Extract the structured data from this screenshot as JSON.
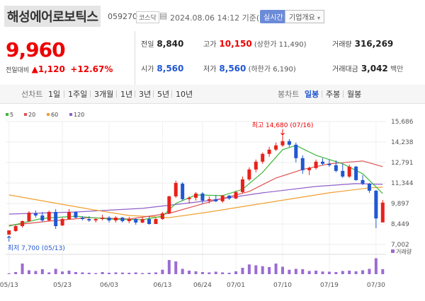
{
  "header": {
    "name": "해성에어로보틱스",
    "code": "059270",
    "market": "코스닥",
    "timestamp": "2024.08.06 14:12 기준(장중)",
    "realtime_label": "실시간",
    "overview_label": "기업개요",
    "overview_caret": "▾"
  },
  "price": {
    "current": "9,960",
    "change_label": "전일대비",
    "change_arrow": "▲",
    "change_amount": "1,120",
    "change_pct": "+12.67%"
  },
  "stats": {
    "prev_label": "전일",
    "prev": "8,840",
    "high_label": "고가",
    "high": "10,150",
    "upper_limit": "(상한가 11,490)",
    "volume_label": "거래량",
    "volume": "316,269",
    "open_label": "시가",
    "open": "8,560",
    "low_label": "저가",
    "low": "8,560",
    "lower_limit": "(하한가 6,190)",
    "amount_label": "거래대금",
    "amount": "3,042",
    "amount_unit": "백만"
  },
  "toolbar": {
    "line_label": "선차트",
    "line_items": [
      "1일",
      "1주일",
      "3개월",
      "1년",
      "3년",
      "5년",
      "10년"
    ],
    "candle_label": "봉차트",
    "candle_items": [
      "일봉",
      "주봉",
      "월봉"
    ],
    "candle_active": 0
  },
  "colors": {
    "up": "#e8221a",
    "down": "#2157d1",
    "ma5": "#3fb83f",
    "ma20": "#e05050",
    "ma60": "#f0a030",
    "ma120": "#9060c8",
    "volume": "#9c6bd3"
  },
  "chart_data": {
    "type": "candlestick",
    "legend": [
      {
        "label": "5",
        "color": "#3fb83f"
      },
      {
        "label": "20",
        "color": "#e05050"
      },
      {
        "label": "60",
        "color": "#f0a030"
      },
      {
        "label": "120",
        "color": "#9060c8"
      }
    ],
    "yticks": [
      "15,686",
      "14,238",
      "12,791",
      "11,344",
      "9,897",
      "8,449",
      "7,002"
    ],
    "ylim": [
      7002,
      15686
    ],
    "xticks": [
      {
        "label": "05/13",
        "idx": 0
      },
      {
        "label": "05/23",
        "idx": 8
      },
      {
        "label": "06/03",
        "idx": 15
      },
      {
        "label": "06/13",
        "idx": 23
      },
      {
        "label": "06/24",
        "idx": 29
      },
      {
        "label": "07/01",
        "idx": 34
      },
      {
        "label": "07/10",
        "idx": 41
      },
      {
        "label": "07/19",
        "idx": 48
      },
      {
        "label": "07/30",
        "idx": 55
      }
    ],
    "high_label": "최고 14,680 (07/16)",
    "low_label": "최저 7,700 (05/13)",
    "volume_label": "거래량",
    "ohlc": [
      [
        7700,
        8000,
        7700,
        8000
      ],
      [
        7950,
        8400,
        7900,
        8300
      ],
      [
        8300,
        8700,
        8200,
        8650
      ],
      [
        8650,
        9350,
        8600,
        9250
      ],
      [
        9200,
        9400,
        8900,
        9050
      ],
      [
        9050,
        9300,
        8600,
        8700
      ],
      [
        8700,
        9400,
        8650,
        9300
      ],
      [
        9300,
        9500,
        8100,
        8300
      ],
      [
        8350,
        8900,
        8300,
        8800
      ],
      [
        8800,
        9500,
        8750,
        9300
      ],
      [
        9300,
        9350,
        8850,
        8900
      ],
      [
        8900,
        9000,
        8700,
        8800
      ],
      [
        8800,
        9000,
        8600,
        8700
      ],
      [
        8700,
        8850,
        8550,
        8800
      ],
      [
        8800,
        9100,
        8700,
        8900
      ],
      [
        8900,
        9000,
        8550,
        8700
      ],
      [
        8700,
        9000,
        8550,
        8900
      ],
      [
        8900,
        8950,
        8550,
        8650
      ],
      [
        8650,
        8950,
        8500,
        8800
      ],
      [
        8800,
        8850,
        8400,
        8550
      ],
      [
        8550,
        8900,
        8500,
        8800
      ],
      [
        8800,
        9000,
        8400,
        8450
      ],
      [
        8450,
        8900,
        8450,
        8800
      ],
      [
        8800,
        9300,
        8750,
        9200
      ],
      [
        9200,
        10450,
        9150,
        10400
      ],
      [
        10400,
        11500,
        10300,
        11350
      ],
      [
        11300,
        11400,
        10100,
        10200
      ],
      [
        10200,
        10400,
        9900,
        10300
      ],
      [
        10300,
        10700,
        10100,
        10600
      ],
      [
        10600,
        10700,
        9900,
        10100
      ],
      [
        10100,
        10400,
        9900,
        10200
      ],
      [
        10200,
        10500,
        10000,
        10050
      ],
      [
        10050,
        10500,
        9950,
        10450
      ],
      [
        10450,
        10500,
        10150,
        10250
      ],
      [
        10250,
        10800,
        10200,
        10700
      ],
      [
        10700,
        11800,
        10600,
        11600
      ],
      [
        11600,
        12450,
        11500,
        12300
      ],
      [
        12300,
        13000,
        12100,
        12850
      ],
      [
        12850,
        13500,
        12700,
        13400
      ],
      [
        13400,
        13900,
        13200,
        13700
      ],
      [
        13700,
        14200,
        13600,
        14000
      ],
      [
        14000,
        14680,
        13900,
        14300
      ],
      [
        14300,
        14450,
        13900,
        14050
      ],
      [
        14050,
        14200,
        12800,
        13100
      ],
      [
        13100,
        13300,
        12000,
        12250
      ],
      [
        12250,
        12500,
        11900,
        12400
      ],
      [
        12400,
        13000,
        12300,
        12850
      ],
      [
        12850,
        13100,
        12600,
        12700
      ],
      [
        12700,
        13000,
        12500,
        12600
      ],
      [
        12600,
        12950,
        12100,
        12200
      ],
      [
        12200,
        12700,
        11700,
        11800
      ],
      [
        11800,
        12650,
        11700,
        12500
      ],
      [
        12500,
        12550,
        11500,
        11550
      ],
      [
        11550,
        11900,
        11200,
        11300
      ],
      [
        11300,
        11350,
        10650,
        10800
      ],
      [
        10800,
        10850,
        8150,
        8840
      ],
      [
        8560,
        10150,
        8560,
        9960
      ]
    ],
    "ma5": [
      [
        0,
        8300
      ],
      [
        5,
        8850
      ],
      [
        10,
        9000
      ],
      [
        15,
        8800
      ],
      [
        20,
        8750
      ],
      [
        23,
        9000
      ],
      [
        25,
        9900
      ],
      [
        28,
        10500
      ],
      [
        32,
        10450
      ],
      [
        35,
        10900
      ],
      [
        38,
        12100
      ],
      [
        41,
        13700
      ],
      [
        43,
        14000
      ],
      [
        46,
        13300
      ],
      [
        50,
        12700
      ],
      [
        53,
        12000
      ],
      [
        56,
        10600
      ]
    ],
    "ma20": [
      [
        0,
        8350
      ],
      [
        6,
        8650
      ],
      [
        12,
        8900
      ],
      [
        18,
        8800
      ],
      [
        24,
        9200
      ],
      [
        30,
        10000
      ],
      [
        36,
        10750
      ],
      [
        40,
        11700
      ],
      [
        44,
        12300
      ],
      [
        48,
        12700
      ],
      [
        53,
        12900
      ],
      [
        56,
        12500
      ]
    ],
    "ma60": [
      [
        0,
        10500
      ],
      [
        6,
        10000
      ],
      [
        12,
        9500
      ],
      [
        18,
        9050
      ],
      [
        24,
        8900
      ],
      [
        30,
        9300
      ],
      [
        36,
        9750
      ],
      [
        42,
        10200
      ],
      [
        48,
        10650
      ],
      [
        54,
        11000
      ],
      [
        56,
        11050
      ]
    ],
    "ma120": [
      [
        0,
        9150
      ],
      [
        10,
        9300
      ],
      [
        20,
        9550
      ],
      [
        30,
        10100
      ],
      [
        38,
        10650
      ],
      [
        46,
        11100
      ],
      [
        52,
        11300
      ],
      [
        56,
        11250
      ]
    ],
    "volume": [
      0.05,
      0.12,
      0.6,
      0.22,
      0.18,
      0.28,
      0.1,
      0.3,
      0.15,
      0.2,
      0.12,
      0.1,
      0.08,
      0.06,
      0.12,
      0.08,
      0.1,
      0.09,
      0.08,
      0.1,
      0.06,
      0.08,
      0.1,
      0.25,
      0.8,
      0.72,
      0.3,
      0.2,
      0.16,
      0.12,
      0.1,
      0.14,
      0.1,
      0.08,
      0.16,
      0.36,
      0.55,
      0.5,
      0.45,
      0.4,
      0.6,
      0.42,
      0.25,
      0.3,
      0.28,
      0.18,
      0.2,
      0.15,
      0.14,
      0.12,
      0.18,
      0.2,
      0.16,
      0.22,
      0.3,
      0.9,
      0.28
    ]
  }
}
